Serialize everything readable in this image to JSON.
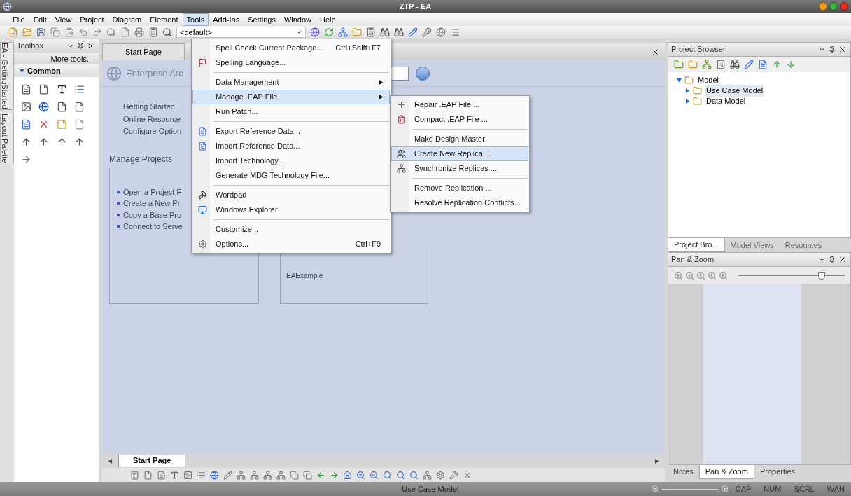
{
  "window": {
    "title": "ZTP - EA"
  },
  "menu_bar": [
    {
      "label": "File",
      "selected": false
    },
    {
      "label": "Edit",
      "selected": false
    },
    {
      "label": "View",
      "selected": false
    },
    {
      "label": "Project",
      "selected": false
    },
    {
      "label": "Diagram",
      "selected": false
    },
    {
      "label": "Element",
      "selected": false
    },
    {
      "label": "Tools",
      "selected": true
    },
    {
      "label": "Add-Ins",
      "selected": false
    },
    {
      "label": "Settings",
      "selected": false
    },
    {
      "label": "Window",
      "selected": false
    },
    {
      "label": "Help",
      "selected": false
    }
  ],
  "toolbar": {
    "profile_dropdown": "<default>"
  },
  "side_tabs": [
    {
      "label": "EA - GettingStarted"
    },
    {
      "label": "Layout Palette"
    }
  ],
  "toolbox": {
    "title": "Toolbox",
    "more_tools": "More tools...",
    "section": {
      "label": "Common",
      "expanded": true
    }
  },
  "document": {
    "tabs": [
      {
        "label": "Start Page",
        "selected": true
      }
    ],
    "start_page": {
      "heading": "Enterprise Arc",
      "links": [
        "Getting Started",
        "Online Resource",
        "Configure Option"
      ],
      "manage_title": "Manage Projects",
      "projects": [
        "Open a Project F",
        "Create a New Pr",
        "Copy a Base Pro",
        "Connect to Serve"
      ],
      "recent": "EAExample"
    },
    "bottom_tabs": [
      {
        "label": "Start Page",
        "selected": true
      }
    ]
  },
  "tools_menu": [
    {
      "label": "Spell Check Current Package...",
      "shortcut": "Ctrl+Shift+F7",
      "submenu": false,
      "selected": false,
      "separator_before": false
    },
    {
      "label": "Spelling Language...",
      "submenu": false,
      "selected": false,
      "separator_before": false
    },
    {
      "label": "Data Management",
      "submenu": true,
      "selected": false,
      "separator_before": true
    },
    {
      "label": "Manage .EAP File",
      "submenu": true,
      "selected": true,
      "separator_before": false
    },
    {
      "label": "Run Patch...",
      "submenu": false,
      "selected": false,
      "separator_before": false
    },
    {
      "label": "Export Reference Data...",
      "submenu": false,
      "selected": false,
      "separator_before": true
    },
    {
      "label": "Import Reference Data...",
      "submenu": false,
      "selected": false,
      "separator_before": false
    },
    {
      "label": "Import Technology...",
      "submenu": false,
      "selected": false,
      "separator_before": false
    },
    {
      "label": "Generate MDG Technology File...",
      "submenu": false,
      "selected": false,
      "separator_before": false
    },
    {
      "label": "Wordpad",
      "submenu": false,
      "selected": false,
      "separator_before": true
    },
    {
      "label": "Windows Explorer",
      "submenu": false,
      "selected": false,
      "separator_before": false
    },
    {
      "label": "Customize...",
      "submenu": false,
      "selected": false,
      "separator_before": true
    },
    {
      "label": "Options...",
      "shortcut": "Ctrl+F9",
      "submenu": false,
      "selected": false,
      "separator_before": false
    }
  ],
  "eap_submenu": [
    {
      "label": "Repair .EAP File ...",
      "selected": false,
      "separator_before": false
    },
    {
      "label": "Compact .EAP File ...",
      "selected": false,
      "separator_before": false
    },
    {
      "label": "Make Design Master",
      "selected": false,
      "separator_before": true
    },
    {
      "label": "Create New Replica ...",
      "selected": true,
      "separator_before": false
    },
    {
      "label": "Synchronize Replicas ...",
      "selected": false,
      "separator_before": false
    },
    {
      "label": "Remove Replication ...",
      "selected": false,
      "separator_before": true
    },
    {
      "label": "Resolve Replication Conflicts...",
      "selected": false,
      "separator_before": false
    }
  ],
  "project_browser": {
    "title": "Project Browser",
    "tree": [
      {
        "label": "Model",
        "expanded": true,
        "children": [
          {
            "label": "Use Case Model",
            "selected": true,
            "expanded": false
          },
          {
            "label": "Data Model",
            "selected": false,
            "expanded": false
          }
        ]
      }
    ],
    "tabs": [
      {
        "label": "Project Bro...",
        "selected": true
      },
      {
        "label": "Model Views",
        "selected": false
      },
      {
        "label": "Resources",
        "selected": false
      }
    ]
  },
  "pan_zoom": {
    "title": "Pan & Zoom",
    "level": 0.78
  },
  "bottom_right_tabs": [
    {
      "label": "Notes",
      "selected": false
    },
    {
      "label": "Pan & Zoom",
      "selected": true
    },
    {
      "label": "Properties",
      "selected": false
    }
  ],
  "status_bar": {
    "text": "Use Case Model",
    "indicators": [
      "CAP",
      "NUM",
      "SCRL",
      "WAN"
    ]
  }
}
